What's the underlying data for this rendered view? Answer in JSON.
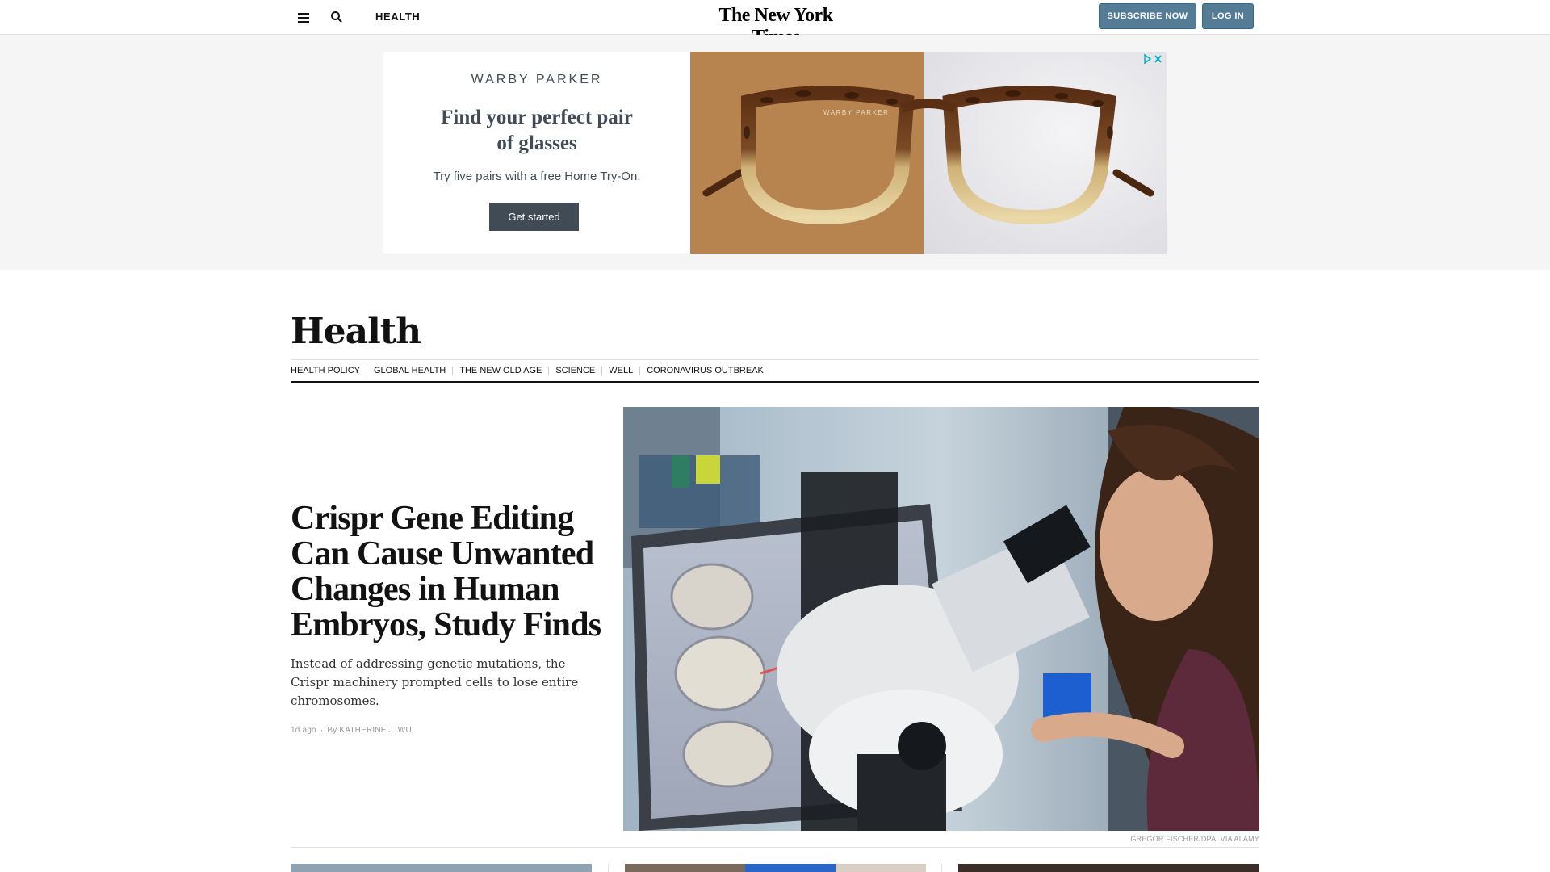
{
  "topbar": {
    "menu_icon": "hamburger-menu-icon",
    "search_icon": "search-icon",
    "section_label": "HEALTH",
    "masthead": "The New York Times",
    "subscribe_label": "SUBSCRIBE NOW",
    "login_label": "LOG IN"
  },
  "ad": {
    "brand": "WARBY PARKER",
    "headline": "Find your perfect pair of glasses",
    "subtext": "Try five pairs with a free Home Try-On.",
    "cta": "Get started",
    "frame_text": "WARBY PARKER",
    "adchoices_icon": "adchoices-icon",
    "colors": {
      "ink": "#414b56",
      "left_bg": "#b78450",
      "right_bg": "#e9e9ec"
    }
  },
  "section": {
    "title": "Health",
    "subnav": [
      "HEALTH POLICY",
      "GLOBAL HEALTH",
      "THE NEW OLD AGE",
      "SCIENCE",
      "WELL",
      "CORONAVIRUS OUTBREAK"
    ]
  },
  "lead_story": {
    "headline": "Crispr Gene Editing Can Cause Unwanted Changes in Human Embryos, Study Finds",
    "summary": "Instead of addressing genetic mutations, the Crispr machinery prompted cells to lose entire chromosomes.",
    "timestamp": "1d ago",
    "byline": "By KATHERINE J. WU",
    "image_credit": "GREGOR FISCHER/DPA, VIA ALAMY"
  },
  "colors": {
    "button_bg": "#567b95",
    "button_border": "#326891"
  }
}
